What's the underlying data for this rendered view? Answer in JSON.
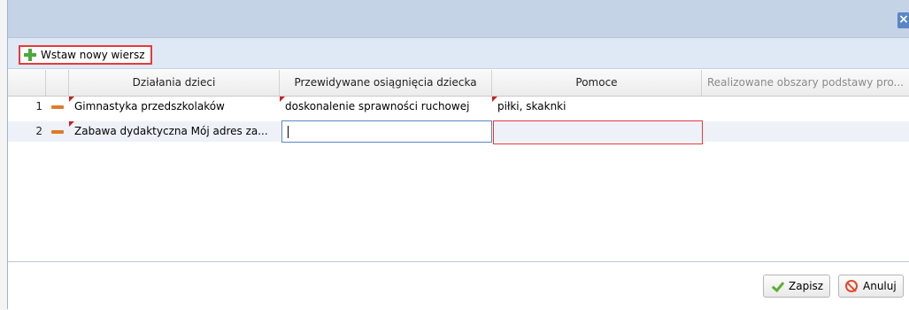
{
  "window": {
    "close_glyph": "×"
  },
  "toolbar": {
    "insert_row_label": "Wstaw nowy wiersz",
    "insert_icon": "plus-icon"
  },
  "grid": {
    "columns": [
      {
        "label": ""
      },
      {
        "label": ""
      },
      {
        "label": "Działania dzieci"
      },
      {
        "label": "Przewidywane osiągnięcia dziecka"
      },
      {
        "label": "Pomoce"
      },
      {
        "label": "Realizowane obszary podstawy pro..."
      }
    ],
    "rows": [
      {
        "num": "1",
        "dzialania": "Gimnastyka przedszkolaków",
        "osiagniecia": "doskonalenie sprawności ruchowej",
        "pomoce": "piłki, skaknki",
        "obszary": ""
      },
      {
        "num": "2",
        "dzialania": "Zabawa dydaktyczna Mój adres za...",
        "osiagniecia": "",
        "pomoce": "",
        "obszary": ""
      }
    ]
  },
  "footer": {
    "save_label": "Zapisz",
    "cancel_label": "Anuluj"
  },
  "colors": {
    "accent": "#5a86c4",
    "highlight": "#e53a3a",
    "add": "#4aa83c",
    "remove": "#e07a2b"
  }
}
